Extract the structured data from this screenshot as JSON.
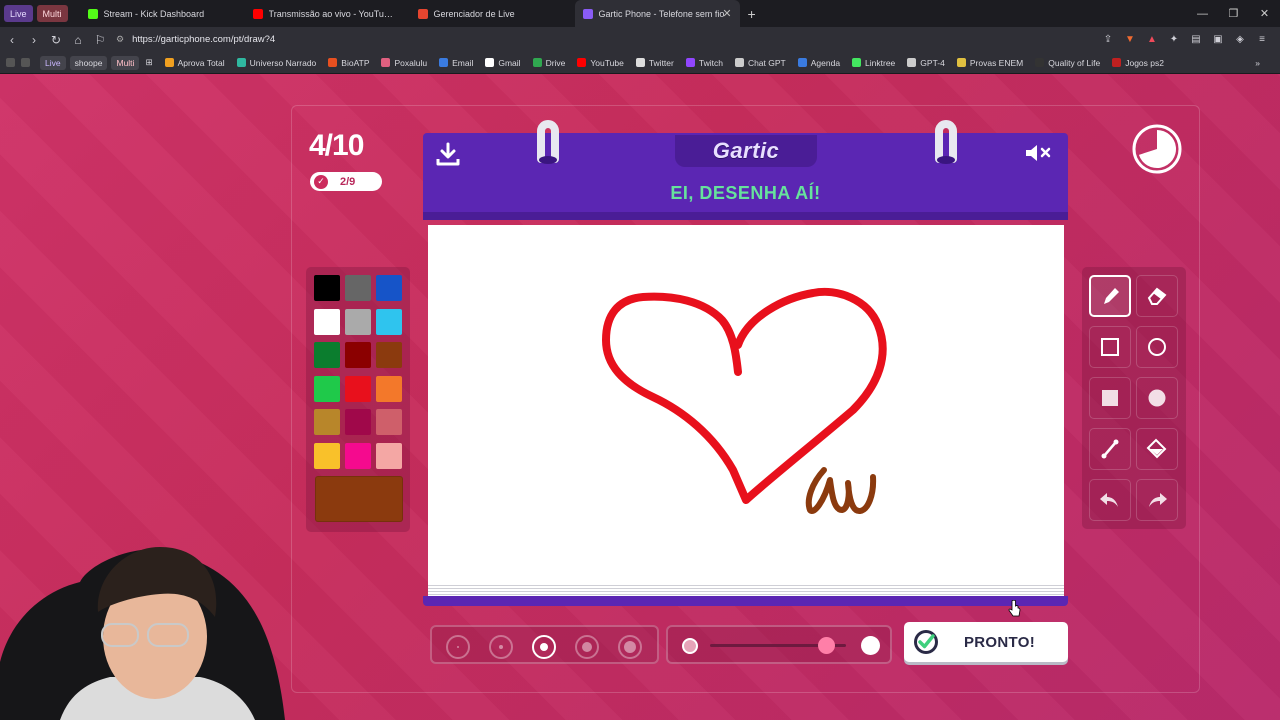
{
  "browser": {
    "workspaces": [
      "Live",
      "Multi"
    ],
    "tabs": [
      {
        "title": "Stream - Kick Dashboard",
        "color": "#53fc18",
        "active": false
      },
      {
        "title": "Transmissão ao vivo - YouTube Studio",
        "color": "#ff0000",
        "active": false
      },
      {
        "title": "Gerenciador de Live",
        "color": "#e6452f",
        "active": false
      },
      {
        "title": "Gartic Phone - Telefone sem fio",
        "color": "#8a5cf5",
        "active": true
      }
    ],
    "url": "https://garticphone.com/pt/draw?4",
    "bookmark_folders": [
      "Live",
      "shoope",
      "Multi"
    ],
    "bookmarks": [
      {
        "label": "Aprova Total",
        "color": "#f0a020"
      },
      {
        "label": "Universo Narrado",
        "color": "#2fb8a0"
      },
      {
        "label": "BioATP",
        "color": "#e85020"
      },
      {
        "label": "Poxalulu",
        "color": "#e06080"
      },
      {
        "label": "Email",
        "color": "#3a7be0"
      },
      {
        "label": "Gmail",
        "color": "#ffffff"
      },
      {
        "label": "Drive",
        "color": "#30a850"
      },
      {
        "label": "YouTube",
        "color": "#ff0000"
      },
      {
        "label": "Twitter",
        "color": "#dddddd"
      },
      {
        "label": "Twitch",
        "color": "#9146ff"
      },
      {
        "label": "Chat GPT",
        "color": "#cccccc"
      },
      {
        "label": "Agenda",
        "color": "#3a7be0"
      },
      {
        "label": "Linktree",
        "color": "#43e660"
      },
      {
        "label": "GPT-4",
        "color": "#cccccc"
      },
      {
        "label": "Provas ENEM",
        "color": "#e0c040"
      },
      {
        "label": "Quality of Life",
        "color": "#333333"
      },
      {
        "label": "Jogos ps2",
        "color": "#c02020"
      }
    ]
  },
  "game": {
    "round": "4/10",
    "players_done": "2/9",
    "logo": "Gartic",
    "board_title": "EI, DESENHA AÍ!",
    "ready_label": "PRONTO!",
    "timer_remaining_fraction": 0.7,
    "current_color": "#8b3a0e",
    "selected_brush_size_index": 2,
    "opacity_level": 0.85,
    "palette": [
      "#000000",
      "#666666",
      "#1654c8",
      "#ffffff",
      "#aaaaaa",
      "#2fc4ee",
      "#0b7d2e",
      "#8b0000",
      "#8b3a0e",
      "#1fc94a",
      "#e8101c",
      "#f3782a",
      "#b8862a",
      "#a0084a",
      "#cf5f6a",
      "#f9c12a",
      "#f50a8e",
      "#f4a7a4"
    ],
    "tools": [
      {
        "name": "pencil",
        "active": true
      },
      {
        "name": "eraser",
        "active": false
      },
      {
        "name": "rectangle-outline",
        "active": false
      },
      {
        "name": "circle-outline",
        "active": false
      },
      {
        "name": "rectangle-filled",
        "active": false
      },
      {
        "name": "circle-filled",
        "active": false
      },
      {
        "name": "line",
        "active": false
      },
      {
        "name": "fill-bucket",
        "active": false
      },
      {
        "name": "undo",
        "active": false
      },
      {
        "name": "redo",
        "active": false
      }
    ],
    "drawing": {
      "heart_color": "#e8101c",
      "scribble_color": "#8b3a0e"
    }
  }
}
